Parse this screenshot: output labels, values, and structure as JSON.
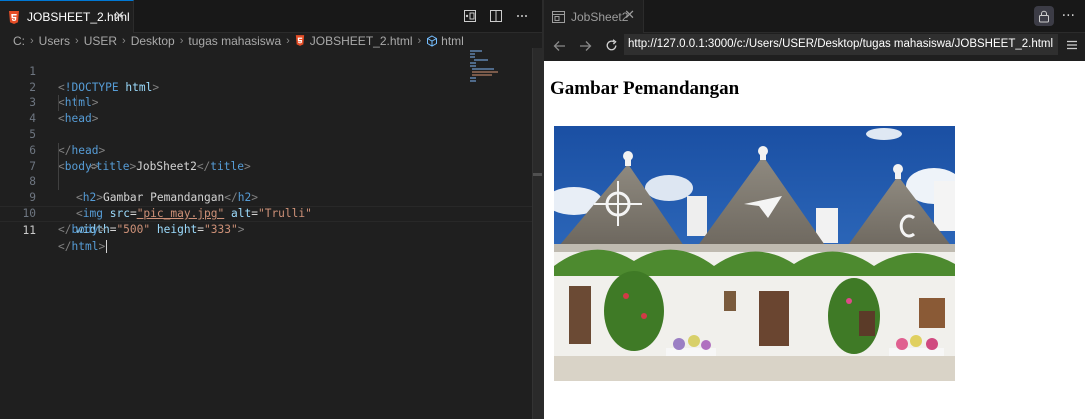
{
  "editor": {
    "tab": {
      "label": "JOBSHEET_2.html",
      "close": "✕"
    },
    "breadcrumb": [
      "C:",
      "Users",
      "USER",
      "Desktop",
      "tugas mahasiswa",
      "JOBSHEET_2.html",
      "html"
    ],
    "lines": [
      {
        "n": "1"
      },
      {
        "n": "2"
      },
      {
        "n": "3"
      },
      {
        "n": "4"
      },
      {
        "n": "5"
      },
      {
        "n": "6"
      },
      {
        "n": "7"
      },
      {
        "n": "8"
      },
      {
        "n": "9"
      },
      {
        "n": "10"
      },
      {
        "n": "11"
      }
    ],
    "code": {
      "doctype": "!DOCTYPE",
      "doctype_val": "html",
      "t_html": "html",
      "t_head": "head",
      "t_title": "title",
      "title_text": "JobSheet2",
      "t_body": "body",
      "t_h2": "h2",
      "h2_text": "Gambar Pemandangan",
      "t_img": "img",
      "a_src": "src",
      "v_src": "\"pic_may.jpg\"",
      "a_alt": "alt",
      "v_alt": "\"Trulli\"",
      "a_width": "width",
      "v_width": "\"500\"",
      "a_height": "height",
      "v_height": "\"333\""
    }
  },
  "browser": {
    "tab": {
      "label": "JobSheet2",
      "close": "✕"
    },
    "more": "···",
    "url": "http://127.0.0.1:3000/c:/Users/USER/Desktop/tugas mahasiswa/JOBSHEET_2.html",
    "page": {
      "heading": "Gambar Pemandangan",
      "img_alt": "Trulli"
    }
  },
  "colors": {
    "accent": "#0078d4",
    "html_icon": "#e44d26",
    "tag": "#569cd6",
    "attr": "#9cdcfe",
    "string": "#ce9178"
  }
}
